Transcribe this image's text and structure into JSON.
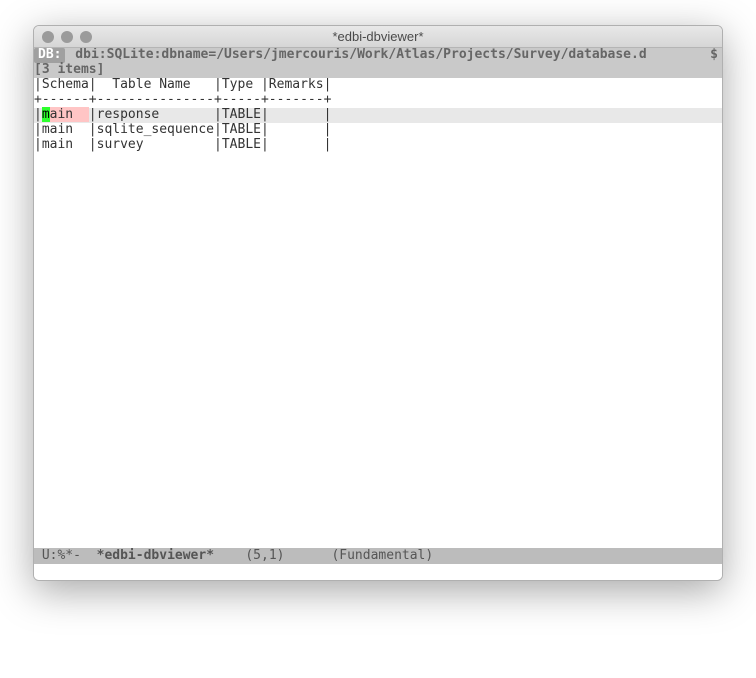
{
  "window": {
    "title": "*edbi-dbviewer*"
  },
  "header": {
    "db_label": "DB:",
    "db_conn": " dbi:SQLite:dbname=/Users/jmercouris/Work/Atlas/Projects/Survey/database.d",
    "truncation_glyph": "$",
    "items_summary": "[3 items]"
  },
  "table": {
    "columns": [
      "Schema",
      "Table Name",
      "Type",
      "Remarks"
    ],
    "header_line": "|Schema|  Table Name   |Type |Remarks|",
    "divider_line": "+------+---------------+-----+-------+",
    "rows": [
      {
        "schema": "main",
        "name": "response",
        "type": "TABLE",
        "remarks": "",
        "highlighted": true,
        "cursor_char": "m",
        "rest_schema": "ain  "
      },
      {
        "schema": "main",
        "name": "sqlite_sequence",
        "type": "TABLE",
        "remarks": "",
        "highlighted": false
      },
      {
        "schema": "main",
        "name": "survey",
        "type": "TABLE",
        "remarks": "",
        "highlighted": false
      }
    ],
    "row_lines": [
      "|response       |TABLE|       |",
      "|main  |sqlite_sequence|TABLE|       |",
      "|main  |survey         |TABLE|       |"
    ]
  },
  "modeline": {
    "left": " U:%*- ",
    "buffer_name": "*edbi-dbviewer*",
    "position": "(5,1)",
    "mode": "(Fundamental)"
  }
}
